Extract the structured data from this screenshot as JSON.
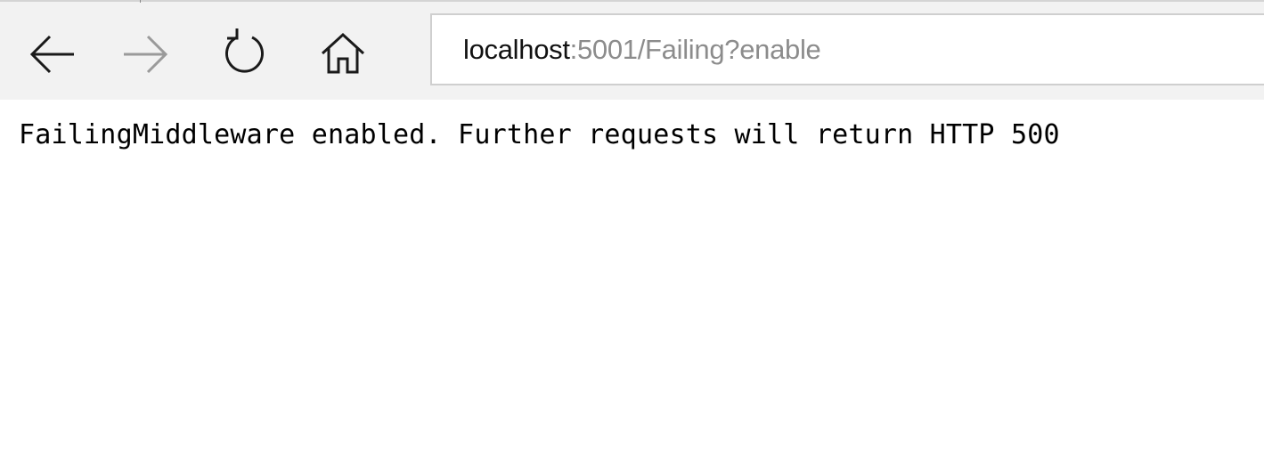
{
  "browser": {
    "nav": {
      "back_icon": "arrow-left-icon",
      "forward_icon": "arrow-right-icon",
      "refresh_icon": "refresh-icon",
      "home_icon": "home-icon"
    },
    "address_bar": {
      "host": "localhost",
      "rest": ":5001/Failing?enable"
    },
    "colors": {
      "toolbar_bg": "#f2f2f2",
      "icon_active": "#1a1a1a",
      "icon_disabled": "#9a9a9a",
      "url_host": "#111111",
      "url_rest": "#8c8c8c"
    }
  },
  "page": {
    "body_text": "FailingMiddleware enabled. Further requests will return HTTP 500"
  }
}
